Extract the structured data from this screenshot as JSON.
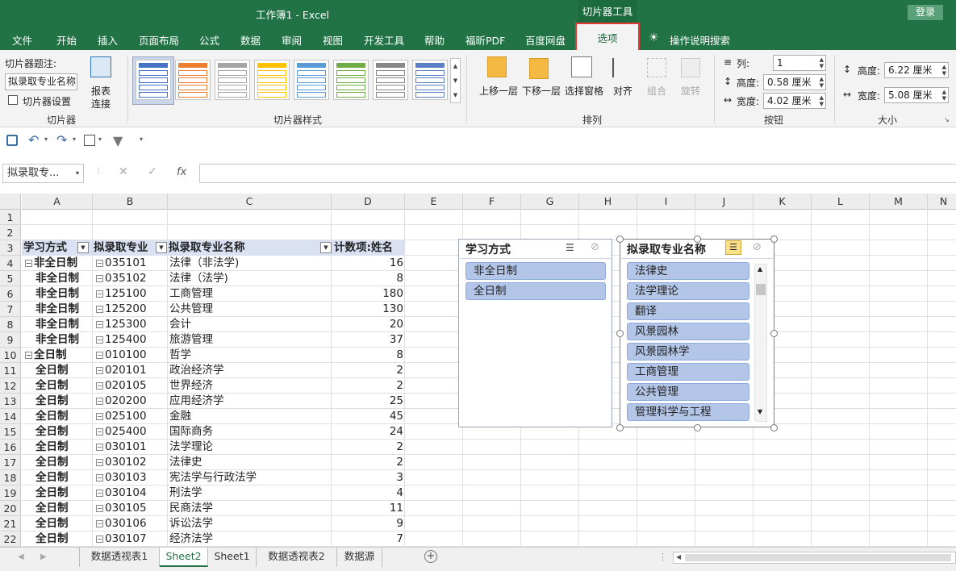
{
  "title": {
    "doc": "工作簿1  -  Excel",
    "context": "切片器工具",
    "login": "登录"
  },
  "tabs": [
    "文件",
    "开始",
    "插入",
    "页面布局",
    "公式",
    "数据",
    "审阅",
    "视图",
    "开发工具",
    "帮助",
    "福昕PDF",
    "百度网盘",
    "选项"
  ],
  "tell_me": "操作说明搜索",
  "ribbon": {
    "caption_label": "切片器题注:",
    "caption_value": "拟录取专业名称",
    "settings": "切片器设置",
    "report_connect": [
      "报表",
      "连接"
    ],
    "group_slicer": "切片器",
    "group_styles": "切片器样式",
    "move_up": "上移一层",
    "move_down": "下移一层",
    "selection_pane": "选择窗格",
    "align": "对齐",
    "group": "组合",
    "rotate": "旋转",
    "group_arrange": "排列",
    "cols_label": "列:",
    "cols_value": "1",
    "btn_height_label": "高度:",
    "btn_height_value": "0.58 厘米",
    "btn_width_label": "宽度:",
    "btn_width_value": "4.02 厘米",
    "group_buttons": "按钮",
    "height_label": "高度:",
    "height_value": "6.22 厘米",
    "width_label": "宽度:",
    "width_value": "5.08 厘米",
    "group_size": "大小"
  },
  "style_swatches": [
    "#4472c4",
    "#ed7d31",
    "#a5a5a5",
    "#ffc000",
    "#5b9bd5",
    "#70ad47",
    "#888888",
    "#5a7fc7"
  ],
  "namebox": "拟录取专...",
  "formula": "",
  "columns": [
    "A",
    "B",
    "C",
    "D",
    "E",
    "F",
    "G",
    "H",
    "I",
    "J",
    "K",
    "L",
    "M",
    "N"
  ],
  "rows": [
    "1",
    "2",
    "3",
    "4",
    "5",
    "6",
    "7",
    "8",
    "9",
    "10",
    "11",
    "12",
    "13",
    "14",
    "15",
    "16",
    "17",
    "18",
    "19",
    "20",
    "21",
    "22"
  ],
  "pivot_headers": [
    "学习方式",
    "拟录取专业",
    "拟录取专业名称",
    "计数项:姓名"
  ],
  "pivot": [
    {
      "a": "非全日制",
      "ag": true,
      "b": "035101",
      "c": "法律（非法学)",
      "d": "16"
    },
    {
      "a": "非全日制",
      "ag": false,
      "b": "035102",
      "c": "法律（法学)",
      "d": "8"
    },
    {
      "a": "非全日制",
      "ag": false,
      "b": "125100",
      "c": "工商管理",
      "d": "180"
    },
    {
      "a": "非全日制",
      "ag": false,
      "b": "125200",
      "c": "公共管理",
      "d": "130"
    },
    {
      "a": "非全日制",
      "ag": false,
      "b": "125300",
      "c": "会计",
      "d": "20"
    },
    {
      "a": "非全日制",
      "ag": false,
      "b": "125400",
      "c": "旅游管理",
      "d": "37"
    },
    {
      "a": "全日制",
      "ag": true,
      "b": "010100",
      "c": "哲学",
      "d": "8"
    },
    {
      "a": "全日制",
      "ag": false,
      "b": "020101",
      "c": "政治经济学",
      "d": "2"
    },
    {
      "a": "全日制",
      "ag": false,
      "b": "020105",
      "c": "世界经济",
      "d": "2"
    },
    {
      "a": "全日制",
      "ag": false,
      "b": "020200",
      "c": "应用经济学",
      "d": "25"
    },
    {
      "a": "全日制",
      "ag": false,
      "b": "025100",
      "c": "金融",
      "d": "45"
    },
    {
      "a": "全日制",
      "ag": false,
      "b": "025400",
      "c": "国际商务",
      "d": "24"
    },
    {
      "a": "全日制",
      "ag": false,
      "b": "030101",
      "c": "法学理论",
      "d": "2"
    },
    {
      "a": "全日制",
      "ag": false,
      "b": "030102",
      "c": "法律史",
      "d": "2"
    },
    {
      "a": "全日制",
      "ag": false,
      "b": "030103",
      "c": "宪法学与行政法学",
      "d": "3"
    },
    {
      "a": "全日制",
      "ag": false,
      "b": "030104",
      "c": "刑法学",
      "d": "4"
    },
    {
      "a": "全日制",
      "ag": false,
      "b": "030105",
      "c": "民商法学",
      "d": "11"
    },
    {
      "a": "全日制",
      "ag": false,
      "b": "030106",
      "c": "诉讼法学",
      "d": "9"
    },
    {
      "a": "全日制",
      "ag": false,
      "b": "030107",
      "c": "经济法学",
      "d": "7"
    }
  ],
  "slicer1": {
    "title": "学习方式",
    "items": [
      "非全日制",
      "全日制"
    ]
  },
  "slicer2": {
    "title": "拟录取专业名称",
    "items": [
      "法律史",
      "法学理论",
      "翻译",
      "风景园林",
      "风景园林学",
      "工商管理",
      "公共管理",
      "管理科学与工程"
    ]
  },
  "sheets": [
    "数据透视表1",
    "Sheet2",
    "Sheet1",
    "数据透视表2",
    "数据源"
  ],
  "active_sheet": "Sheet2"
}
